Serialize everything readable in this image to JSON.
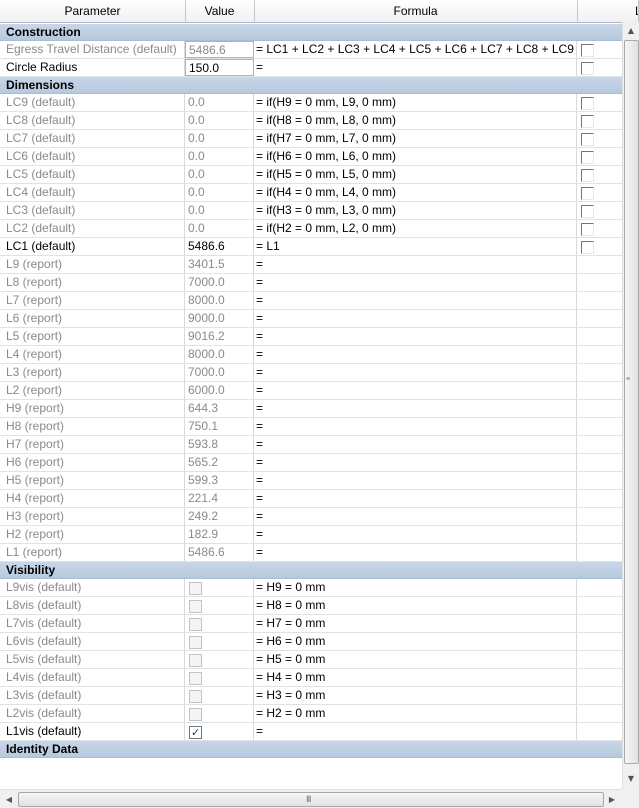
{
  "header": {
    "parameter": "Parameter",
    "value": "Value",
    "formula": "Formula",
    "lock": "Lo"
  },
  "groups": [
    {
      "title": "Construction",
      "rows": [
        {
          "name": "Egress Travel Distance (default)",
          "value": "5486.6",
          "formula": "= LC1 + LC2 + LC3 + LC4 + LC5 + LC6 + LC7 + LC8 + LC9",
          "lock": true,
          "dim": true,
          "box": true
        },
        {
          "name": "Circle Radius",
          "value": "150.0",
          "formula": "=",
          "lock": true,
          "dim": false,
          "box": true
        }
      ]
    },
    {
      "title": "Dimensions",
      "rows": [
        {
          "name": "LC9 (default)",
          "value": "0.0",
          "formula": "= if(H9 = 0 mm, L9, 0 mm)",
          "lock": true,
          "dim": true
        },
        {
          "name": "LC8 (default)",
          "value": "0.0",
          "formula": "= if(H8 = 0 mm, L8, 0 mm)",
          "lock": true,
          "dim": true
        },
        {
          "name": "LC7 (default)",
          "value": "0.0",
          "formula": "= if(H7 = 0 mm, L7, 0 mm)",
          "lock": true,
          "dim": true
        },
        {
          "name": "LC6 (default)",
          "value": "0.0",
          "formula": "= if(H6 = 0 mm, L6, 0 mm)",
          "lock": true,
          "dim": true
        },
        {
          "name": "LC5 (default)",
          "value": "0.0",
          "formula": "= if(H5 = 0 mm, L5, 0 mm)",
          "lock": true,
          "dim": true
        },
        {
          "name": "LC4 (default)",
          "value": "0.0",
          "formula": "= if(H4 = 0 mm, L4, 0 mm)",
          "lock": true,
          "dim": true
        },
        {
          "name": "LC3 (default)",
          "value": "0.0",
          "formula": "= if(H3 = 0 mm, L3, 0 mm)",
          "lock": true,
          "dim": true
        },
        {
          "name": "LC2 (default)",
          "value": "0.0",
          "formula": "= if(H2 = 0 mm, L2, 0 mm)",
          "lock": true,
          "dim": true
        },
        {
          "name": "LC1 (default)",
          "value": "5486.6",
          "formula": "= L1",
          "lock": true,
          "dim": false
        },
        {
          "name": "L9 (report)",
          "value": "3401.5",
          "formula": "=",
          "lock": false,
          "dim": true
        },
        {
          "name": "L8 (report)",
          "value": "7000.0",
          "formula": "=",
          "lock": false,
          "dim": true
        },
        {
          "name": "L7 (report)",
          "value": "8000.0",
          "formula": "=",
          "lock": false,
          "dim": true
        },
        {
          "name": "L6 (report)",
          "value": "9000.0",
          "formula": "=",
          "lock": false,
          "dim": true
        },
        {
          "name": "L5 (report)",
          "value": "9016.2",
          "formula": "=",
          "lock": false,
          "dim": true
        },
        {
          "name": "L4 (report)",
          "value": "8000.0",
          "formula": "=",
          "lock": false,
          "dim": true
        },
        {
          "name": "L3 (report)",
          "value": "7000.0",
          "formula": "=",
          "lock": false,
          "dim": true
        },
        {
          "name": "L2 (report)",
          "value": "6000.0",
          "formula": "=",
          "lock": false,
          "dim": true
        },
        {
          "name": "H9 (report)",
          "value": "644.3",
          "formula": "=",
          "lock": false,
          "dim": true
        },
        {
          "name": "H8 (report)",
          "value": "750.1",
          "formula": "=",
          "lock": false,
          "dim": true
        },
        {
          "name": "H7 (report)",
          "value": "593.8",
          "formula": "=",
          "lock": false,
          "dim": true
        },
        {
          "name": "H6 (report)",
          "value": "565.2",
          "formula": "=",
          "lock": false,
          "dim": true
        },
        {
          "name": "H5 (report)",
          "value": "599.3",
          "formula": "=",
          "lock": false,
          "dim": true
        },
        {
          "name": "H4 (report)",
          "value": "221.4",
          "formula": "=",
          "lock": false,
          "dim": true
        },
        {
          "name": "H3 (report)",
          "value": "249.2",
          "formula": "=",
          "lock": false,
          "dim": true
        },
        {
          "name": "H2 (report)",
          "value": "182.9",
          "formula": "=",
          "lock": false,
          "dim": true
        },
        {
          "name": "L1 (report)",
          "value": "5486.6",
          "formula": "=",
          "lock": false,
          "dim": true
        }
      ]
    },
    {
      "title": "Visibility",
      "rows": [
        {
          "name": "L9vis (default)",
          "check": false,
          "formula": "= H9 = 0 mm",
          "dim": true
        },
        {
          "name": "L8vis (default)",
          "check": false,
          "formula": "= H8 = 0 mm",
          "dim": true
        },
        {
          "name": "L7vis (default)",
          "check": false,
          "formula": "= H7 = 0 mm",
          "dim": true
        },
        {
          "name": "L6vis (default)",
          "check": false,
          "formula": "= H6 = 0 mm",
          "dim": true
        },
        {
          "name": "L5vis (default)",
          "check": false,
          "formula": "= H5 = 0 mm",
          "dim": true
        },
        {
          "name": "L4vis (default)",
          "check": false,
          "formula": "= H4 = 0 mm",
          "dim": true
        },
        {
          "name": "L3vis (default)",
          "check": false,
          "formula": "= H3 = 0 mm",
          "dim": true
        },
        {
          "name": "L2vis (default)",
          "check": false,
          "formula": "= H2 = 0 mm",
          "dim": true
        },
        {
          "name": "L1vis (default)",
          "check": true,
          "formula": "=",
          "dim": false
        }
      ]
    },
    {
      "title": "Identity Data",
      "rows": []
    }
  ],
  "scroll": {
    "up": "▲",
    "down": "▼",
    "left": "◀",
    "right": "▶",
    "grip_v": "≡",
    "grip_h": "III"
  }
}
